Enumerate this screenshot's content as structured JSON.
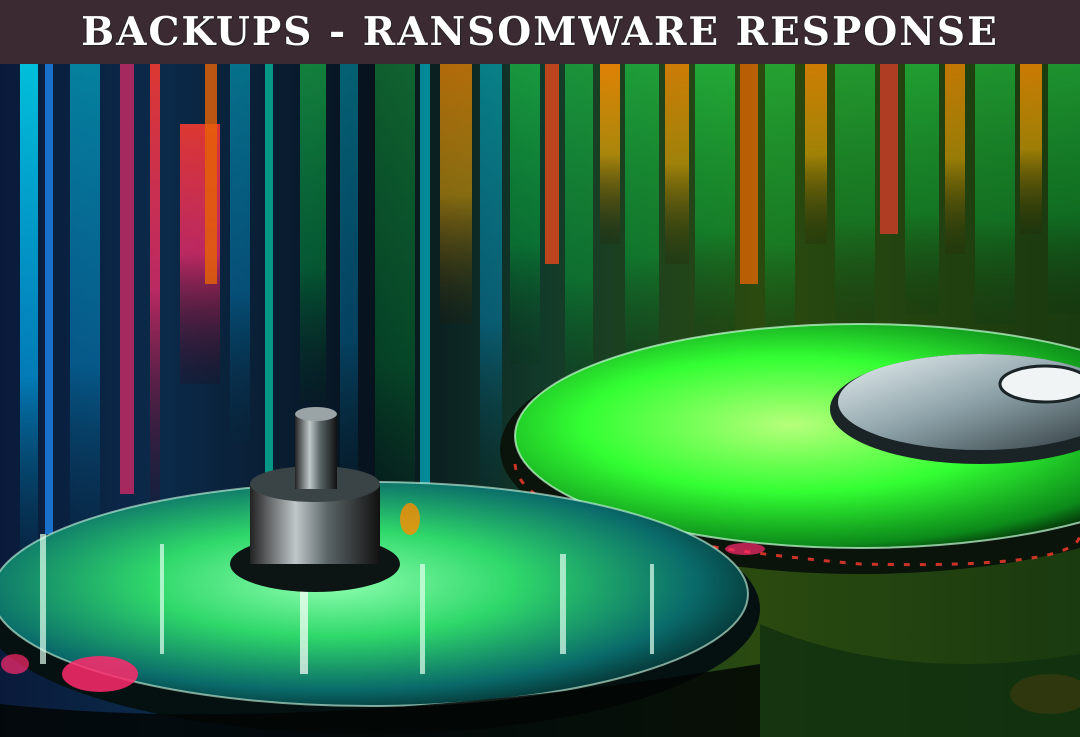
{
  "banner": {
    "title": "BACKUPS - RANSOMWARE RESPONSE",
    "background_color": "#3c2a33",
    "text_color": "#ffffff"
  },
  "photo": {
    "description_icon": "hard-drive-platters-image",
    "palette": [
      "#00ff66",
      "#00e5ff",
      "#ff2a6d",
      "#ff8c00",
      "#1a1a1a"
    ]
  }
}
